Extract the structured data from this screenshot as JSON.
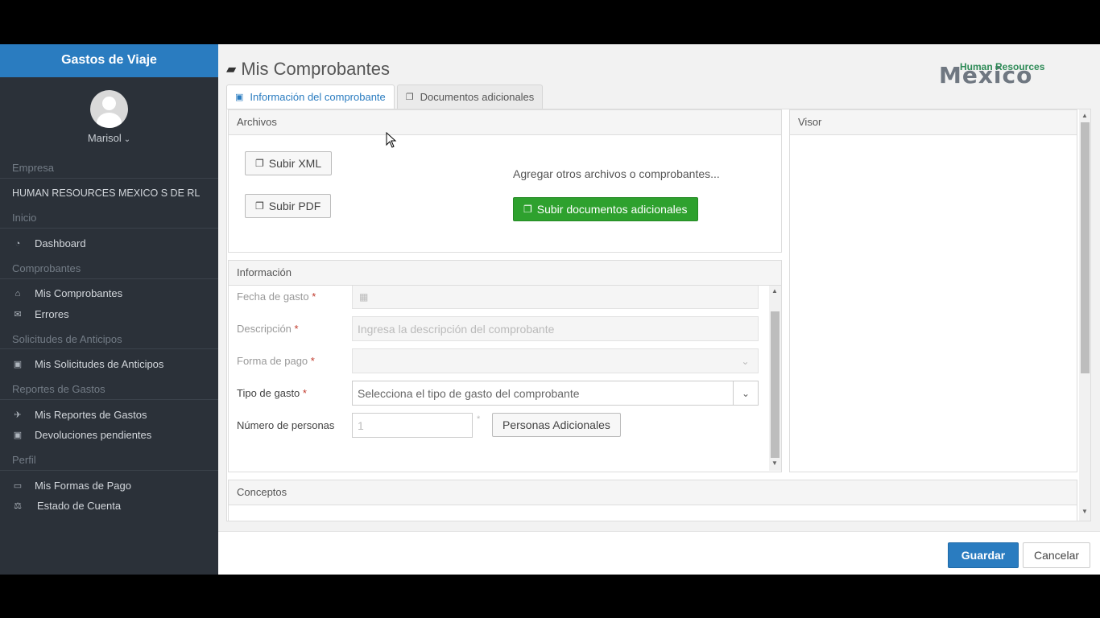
{
  "sidebar": {
    "title": "Gastos de Viaje",
    "user": "Marisol",
    "sections": {
      "empresa": "Empresa",
      "company_name": "HUMAN RESOURCES MEXICO S DE RL",
      "inicio": "Inicio",
      "comprobantes": "Comprobantes",
      "solicitudes": "Solicitudes de Anticipos",
      "reportes": "Reportes de Gastos",
      "perfil": "Perfil"
    },
    "items": [
      {
        "label": "Dashboard",
        "icon": "dashboard-icon"
      },
      {
        "label": "Mis Comprobantes",
        "icon": "inbox-icon"
      },
      {
        "label": "Errores",
        "icon": "envelope-icon"
      },
      {
        "label": "Mis Solicitudes de Anticipos",
        "icon": "money-icon"
      },
      {
        "label": "Mis Reportes de Gastos",
        "icon": "plane-icon"
      },
      {
        "label": "Devoluciones pendientes",
        "icon": "money-icon"
      },
      {
        "label": "Mis Formas de Pago",
        "icon": "credit-card-icon"
      },
      {
        "label": "Estado de Cuenta",
        "icon": "balance-scale-icon"
      }
    ]
  },
  "header": {
    "title": "Mis Comprobantes",
    "logo": {
      "big": "Mexico",
      "small": "Human Resources"
    }
  },
  "tabs": [
    {
      "label": "Información del comprobante",
      "active": true
    },
    {
      "label": "Documentos adicionales",
      "active": false
    }
  ],
  "archivos": {
    "title": "Archivos",
    "upload_xml": "Subir XML",
    "upload_pdf": "Subir PDF",
    "hint": "Agregar otros archivos o comprobantes...",
    "upload_additional": "Subir documentos adicionales"
  },
  "visor": {
    "title": "Visor"
  },
  "informacion": {
    "title": "Información",
    "fields": {
      "fecha": {
        "label": "Fecha de gasto",
        "value": ""
      },
      "descripcion": {
        "label": "Descripción",
        "placeholder": "Ingresa la descripción del comprobante"
      },
      "forma_pago": {
        "label": "Forma de pago",
        "value": ""
      },
      "tipo_gasto": {
        "label": "Tipo de gasto",
        "value": "Selecciona el tipo de gasto del comprobante"
      },
      "personas": {
        "label": "Número de personas",
        "value": "1"
      }
    },
    "personas_button": "Personas Adicionales"
  },
  "conceptos": {
    "title": "Conceptos"
  },
  "footer": {
    "save": "Guardar",
    "cancel": "Cancelar"
  },
  "colors": {
    "accent": "#2a7cc0",
    "success": "#2ea12e",
    "sidebar": "#2b3139"
  }
}
